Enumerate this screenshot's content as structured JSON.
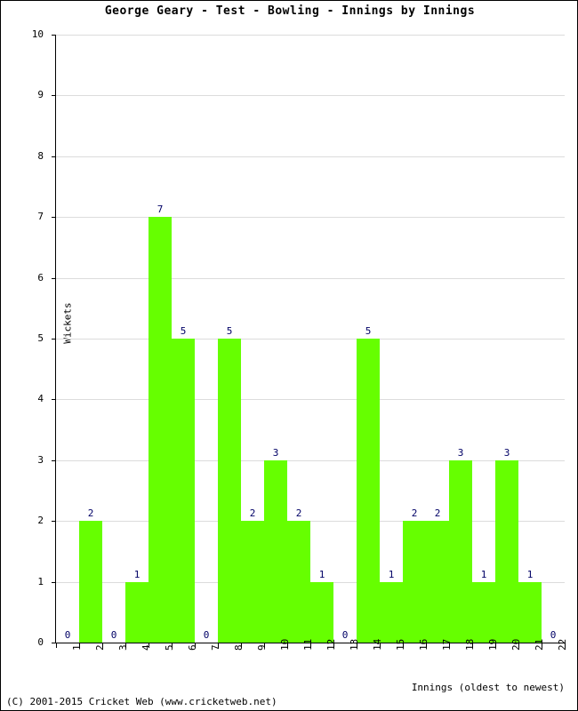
{
  "chart_data": {
    "type": "bar",
    "title": "George Geary - Test - Bowling - Innings by Innings",
    "xlabel": "Innings (oldest to newest)",
    "ylabel": "Wickets",
    "categories": [
      "1",
      "2",
      "3",
      "4",
      "5",
      "6",
      "7",
      "8",
      "9",
      "10",
      "11",
      "12",
      "13",
      "14",
      "15",
      "16",
      "17",
      "18",
      "19",
      "20",
      "21",
      "22"
    ],
    "values": [
      0,
      2,
      0,
      1,
      7,
      5,
      0,
      5,
      2,
      3,
      2,
      1,
      0,
      5,
      1,
      2,
      2,
      3,
      1,
      3,
      1,
      0
    ],
    "ylim": [
      0,
      10
    ],
    "ytick_labels": [
      "10",
      "9",
      "8",
      "7",
      "6",
      "5",
      "4",
      "3",
      "2",
      "1",
      "0"
    ],
    "ytick_values": [
      10,
      9,
      8,
      7,
      6,
      5,
      4,
      3,
      2,
      1,
      0
    ],
    "grid": true,
    "legend": "none",
    "bar_color": "#66ff00",
    "value_label_color": "#000066",
    "gridline_color": "#dcdcdc",
    "axis_color": "#000000"
  },
  "footer": {
    "copyright": "(C) 2001-2015 Cricket Web (www.cricketweb.net)"
  }
}
